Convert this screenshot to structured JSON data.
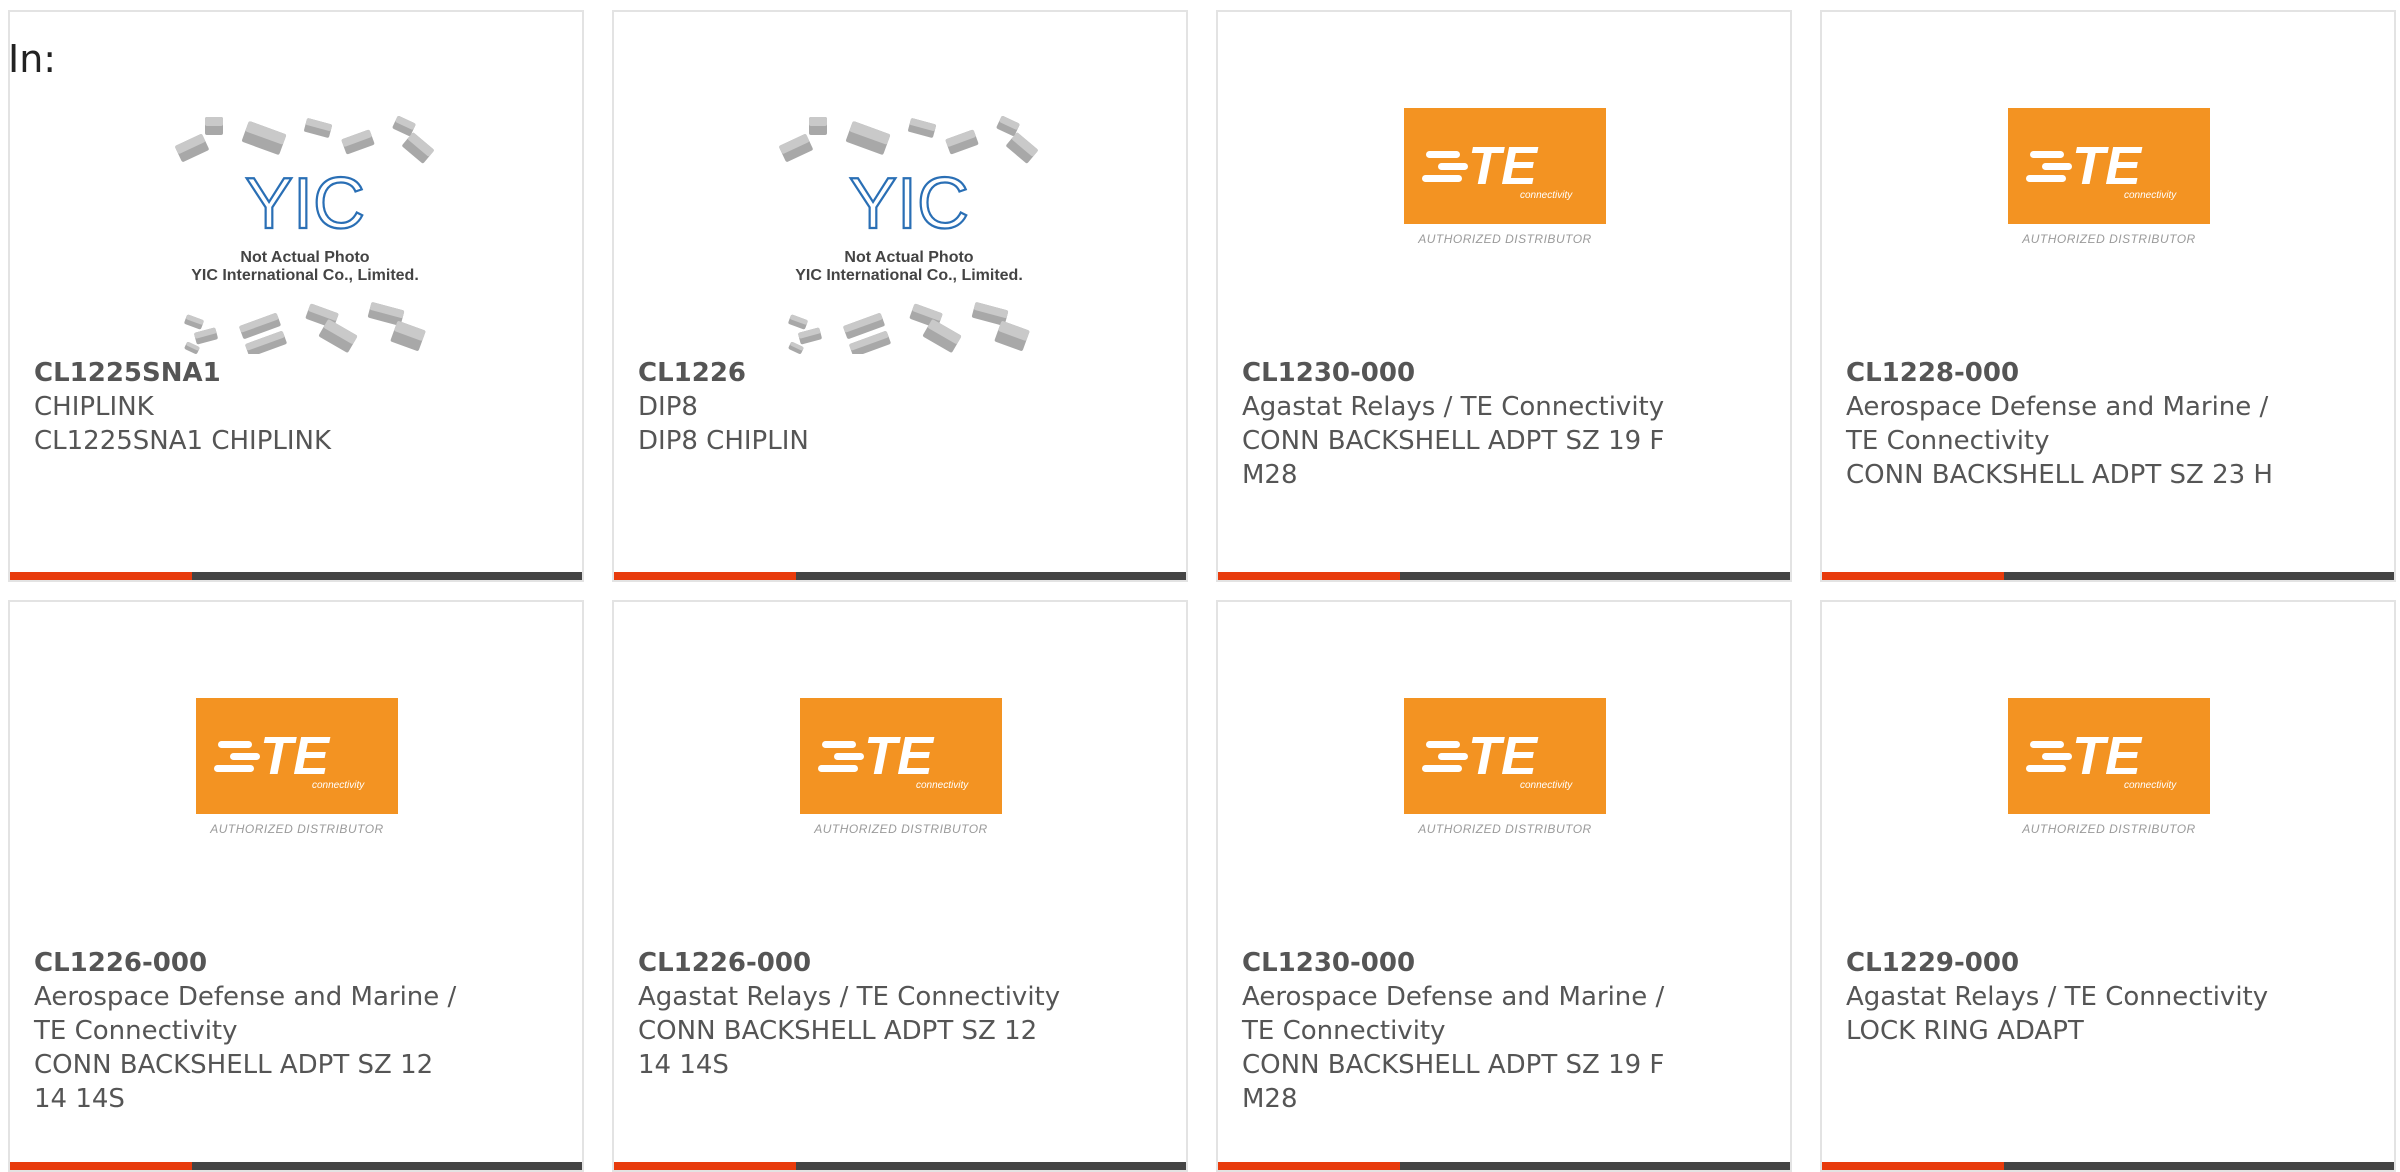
{
  "header": {
    "in_label": "In:"
  },
  "logos": {
    "te_distributor_text": "AUTHORIZED DISTRIBUTOR",
    "te_sub": "connectivity",
    "te_word": "TE",
    "yic_word": "YIC",
    "yic_line1": "Not Actual Photo",
    "yic_line2": "YIC International Co., Limited."
  },
  "colors": {
    "te_orange": "#f39322",
    "bar_accent": "#e83b0c",
    "bar_dark": "#444444",
    "yic_blue": "#2a6fb5"
  },
  "products": [
    {
      "part": "CL1225SNA1",
      "lines": [
        "CHIPLINK",
        "CL1225SNA1 CHIPLINK"
      ],
      "image": "yic"
    },
    {
      "part": "CL1226",
      "lines": [
        "DIP8",
        "DIP8 CHIPLIN"
      ],
      "image": "yic"
    },
    {
      "part": "CL1230-000",
      "lines": [
        "Agastat Relays / TE Connectivity",
        "CONN BACKSHELL ADPT SZ 19 F",
        "M28"
      ],
      "image": "te"
    },
    {
      "part": "CL1228-000",
      "lines": [
        "Aerospace Defense and Marine /",
        "TE Connectivity",
        "CONN BACKSHELL ADPT SZ 23 H"
      ],
      "image": "te"
    },
    {
      "part": "CL1226-000",
      "lines": [
        "Aerospace Defense and Marine /",
        "TE Connectivity",
        "CONN BACKSHELL ADPT SZ 12",
        "14 14S"
      ],
      "image": "te"
    },
    {
      "part": "CL1226-000",
      "lines": [
        "Agastat Relays / TE Connectivity",
        "CONN BACKSHELL ADPT SZ 12",
        "14 14S"
      ],
      "image": "te"
    },
    {
      "part": "CL1230-000",
      "lines": [
        "Aerospace Defense and Marine /",
        "TE Connectivity",
        "CONN BACKSHELL ADPT SZ 19 F",
        "M28"
      ],
      "image": "te"
    },
    {
      "part": "CL1229-000",
      "lines": [
        "Agastat Relays / TE Connectivity",
        "LOCK RING ADAPT"
      ],
      "image": "te"
    }
  ]
}
